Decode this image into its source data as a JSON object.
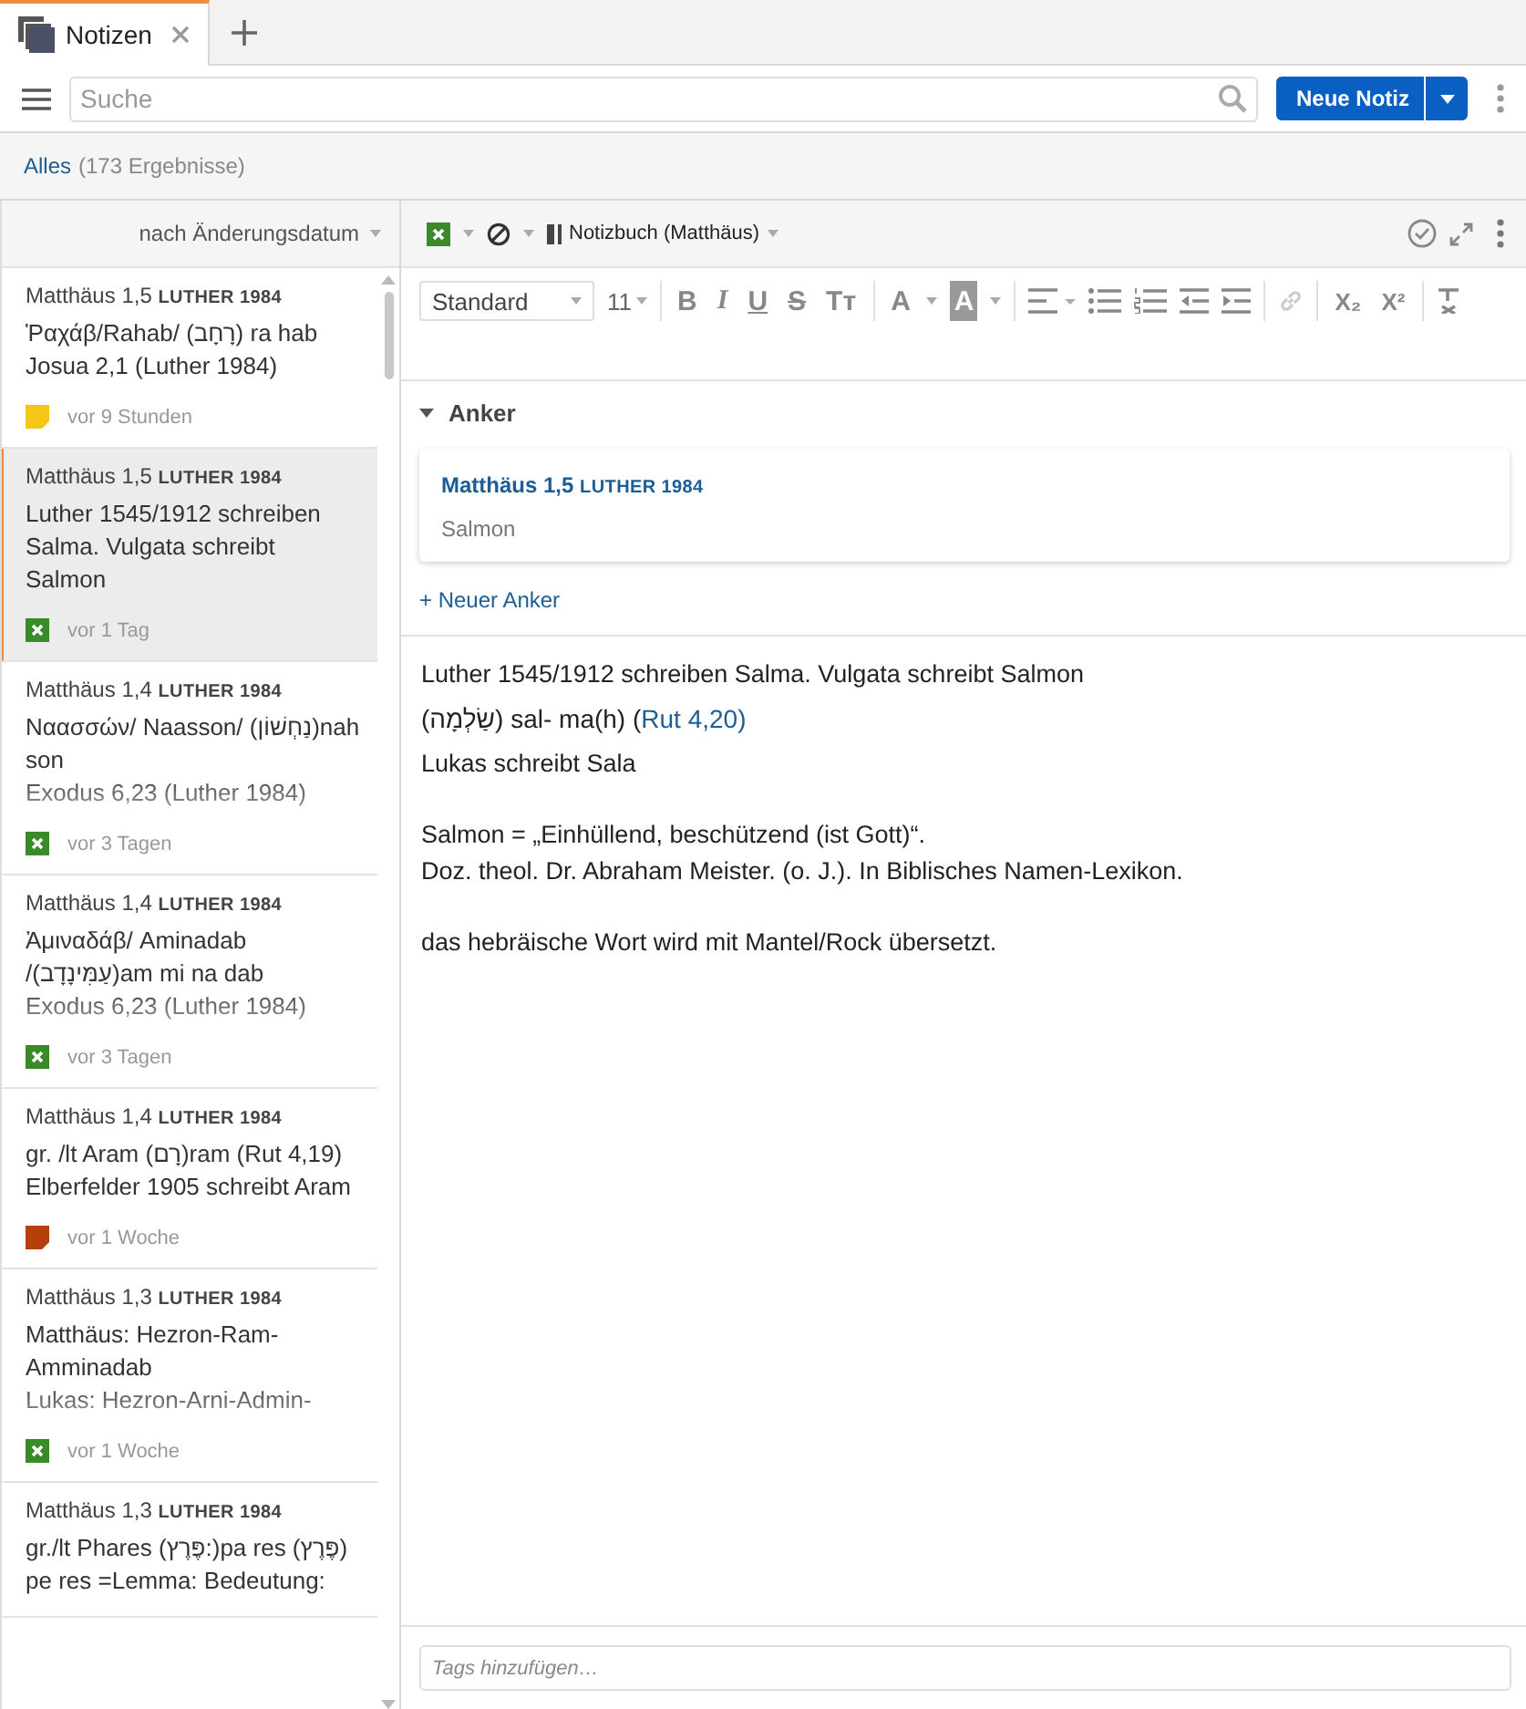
{
  "tabs": [
    {
      "label": "Notizen",
      "selected": true
    }
  ],
  "search": {
    "placeholder": "Suche"
  },
  "new_button": "Neue Notiz",
  "filter": {
    "label": "Alles",
    "count": "(173 Ergebnisse)"
  },
  "sort": "nach Änderungsdatum",
  "notes": [
    {
      "reference": "Matthäus 1,5",
      "version": "LUTHER 1984",
      "lines": [
        "Ῥαχάβ/Rahab/ (רָחָב) ra hab",
        "Josua 2,1 (Luther 1984)"
      ],
      "faded": false,
      "icon": {
        "kind": "sticky",
        "color": "#f5c518"
      },
      "time": "vor 9 Stunden",
      "selected": false
    },
    {
      "reference": "Matthäus 1,5",
      "version": "LUTHER 1984",
      "lines": [
        "Luther 1545/1912 schreiben",
        "Salma. Vulgata schreibt",
        "Salmon"
      ],
      "faded": false,
      "icon": {
        "kind": "marker"
      },
      "time": "vor 1 Tag",
      "selected": true
    },
    {
      "reference": "Matthäus 1,4",
      "version": "LUTHER 1984",
      "lines": [
        "Ναασσών/ Naasson/ (נַחְשׁוֹן)nah",
        "son",
        "Exodus 6,23 (Luther 1984)"
      ],
      "faded": true,
      "icon": {
        "kind": "marker"
      },
      "time": "vor 3 Tagen",
      "selected": false
    },
    {
      "reference": "Matthäus 1,4",
      "version": "LUTHER 1984",
      "lines": [
        "Ἀμιναδάβ/ Aminadab",
        "/(עַמִּינָדָב)am mi na dab",
        "Exodus 6,23 (Luther 1984)"
      ],
      "faded": true,
      "icon": {
        "kind": "marker"
      },
      "time": "vor 3 Tagen",
      "selected": false
    },
    {
      "reference": "Matthäus 1,4",
      "version": "LUTHER 1984",
      "lines": [
        "gr. /lt Aram (רָם)ram (Rut 4,19)",
        "Elberfelder 1905 schreibt Aram"
      ],
      "faded": false,
      "icon": {
        "kind": "sticky",
        "color": "#b5400b"
      },
      "time": "vor 1 Woche",
      "selected": false
    },
    {
      "reference": "Matthäus 1,3",
      "version": "LUTHER 1984",
      "lines": [
        "Matthäus: Hezron-Ram-",
        "Amminadab",
        "Lukas: Hezron-Arni-Admin-"
      ],
      "faded": true,
      "icon": {
        "kind": "marker"
      },
      "time": "vor 1 Woche",
      "selected": false
    },
    {
      "reference": "Matthäus 1,3",
      "version": "LUTHER 1984",
      "lines": [
        "gr./lt Phares (פֶּרֶץ:)pa res (פֶּרֶץ)",
        "pe res =Lemma: Bedeutung:"
      ],
      "faded": false,
      "selected": false
    }
  ],
  "notebook": "Notizbuch (Matthäus)",
  "font": "Standard",
  "size": "11",
  "format_tools": [
    {
      "kind": "bold",
      "label": "B"
    },
    {
      "kind": "italic",
      "label": "I"
    },
    {
      "kind": "underline",
      "label": "U"
    },
    {
      "kind": "strike",
      "label": "S"
    },
    {
      "kind": "textsize",
      "label": "Tт"
    },
    {
      "kind": "sep"
    },
    {
      "kind": "color",
      "label": "A"
    },
    {
      "kind": "highlight",
      "label": "A"
    },
    {
      "kind": "sep"
    },
    {
      "kind": "align"
    },
    {
      "kind": "bullets"
    },
    {
      "kind": "numbers"
    },
    {
      "kind": "outdent"
    },
    {
      "kind": "indent"
    },
    {
      "kind": "sep"
    },
    {
      "kind": "link",
      "disabled": true
    },
    {
      "kind": "sep"
    },
    {
      "kind": "sub",
      "label": "X₂"
    },
    {
      "kind": "super",
      "label": "X²"
    },
    {
      "kind": "sep"
    },
    {
      "kind": "clear"
    }
  ],
  "anchors": {
    "title": "Anker",
    "expanded": true,
    "items": [
      {
        "reference": "Matthäus 1,5",
        "version": "LUTHER 1984",
        "text": "Salmon"
      }
    ],
    "add": "+ Neuer Anker"
  },
  "body": [
    [
      {
        "text": "Luther 1545/1912 schreiben Salma. Vulgata schreibt Salmon"
      },
      {
        "text": "(שַׂלְמָה) sal- ma(h) (",
        "link": "Rut 4,20",
        "after": ")"
      },
      {
        "text": "Lukas schreibt Sala"
      }
    ],
    [
      {
        "text": "Salmon = „Einhüllend, beschützend (ist Gott)“."
      },
      {
        "text": "Doz. theol. Dr. Abraham Meister. (o. J.). In Biblisches Namen-Lexikon."
      }
    ],
    [
      {
        "text": "das hebräische Wort wird mit Mantel/Rock übersetzt."
      }
    ]
  ],
  "tags": {
    "placeholder": "Tags hinzufügen…"
  }
}
